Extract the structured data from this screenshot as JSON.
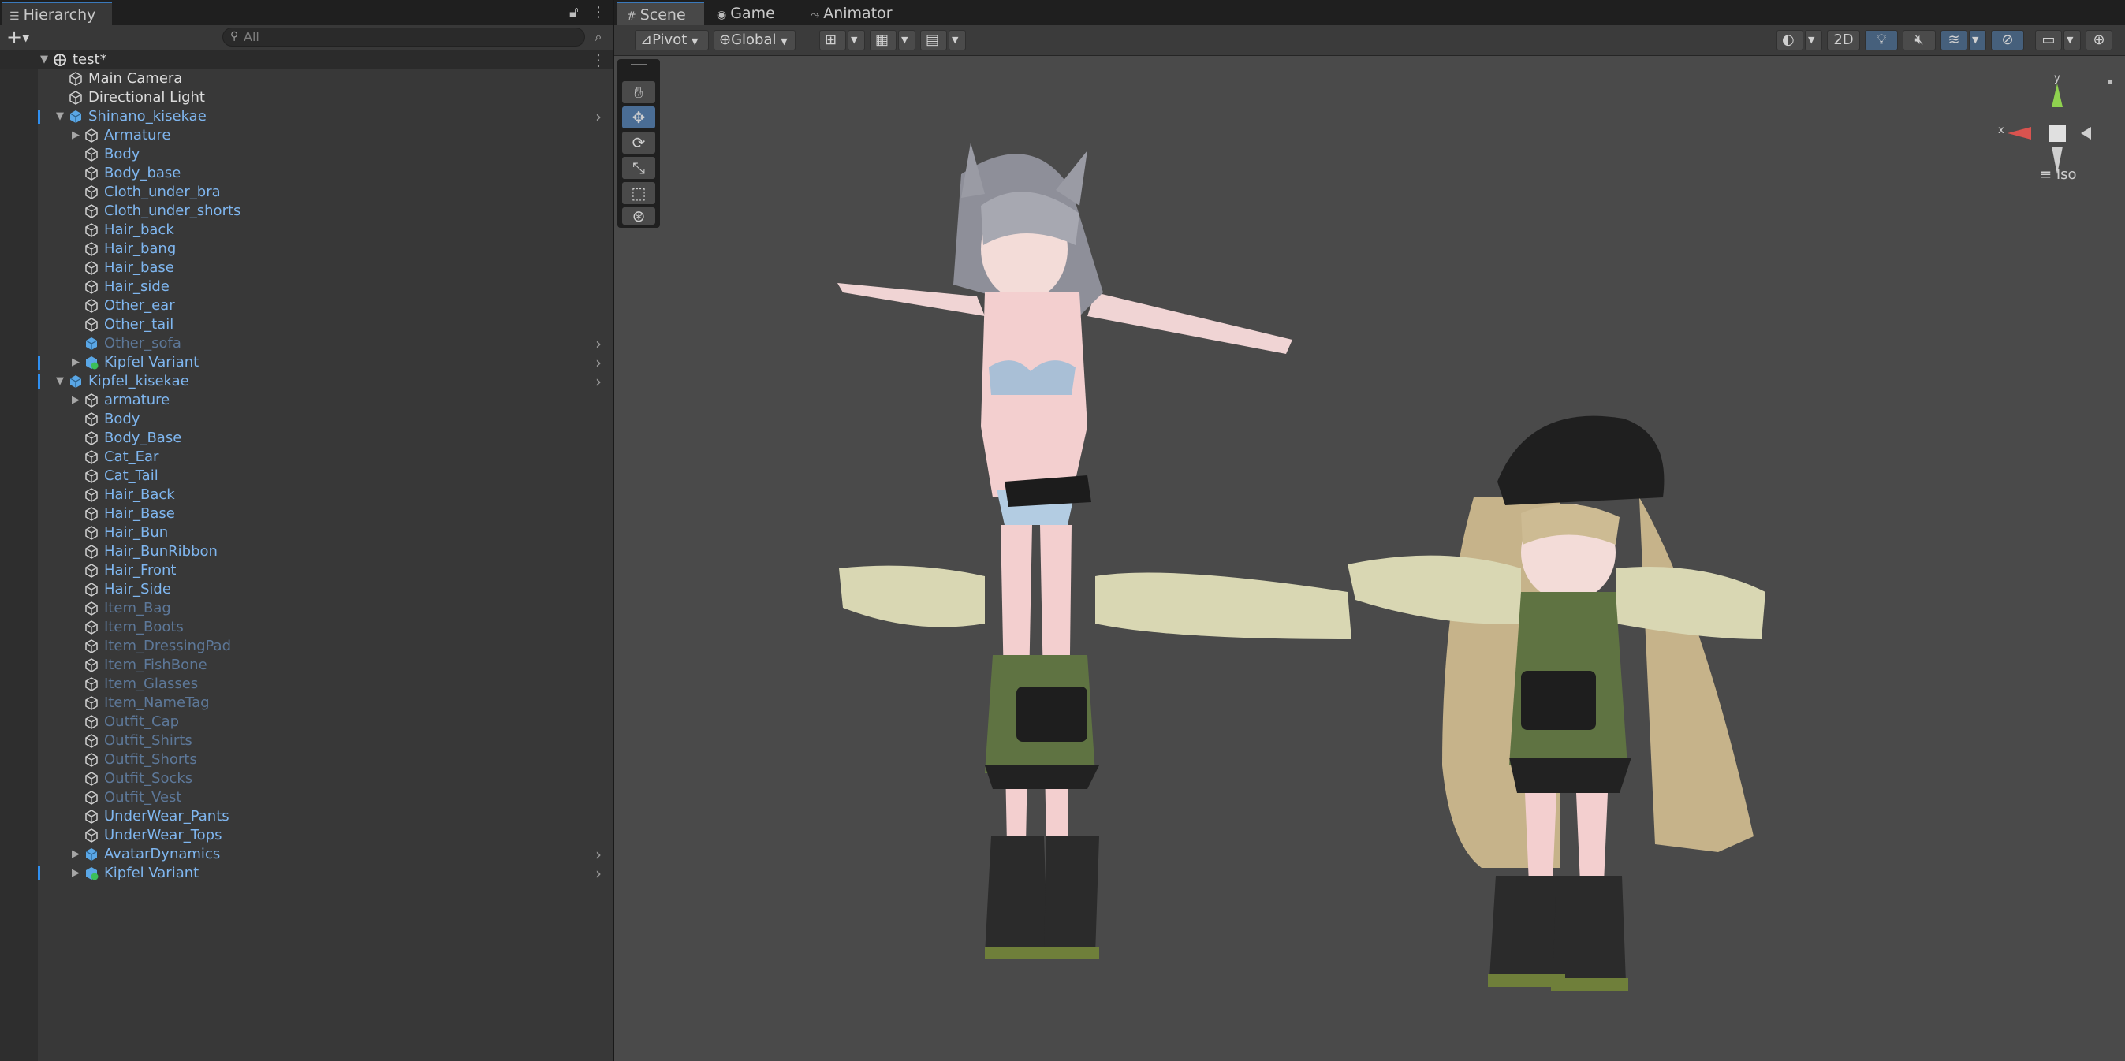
{
  "hierarchy": {
    "tab_label": "Hierarchy",
    "search_placeholder": "All",
    "rows": [
      {
        "label": "test*",
        "indent": 0,
        "kind": "scene",
        "arrow": "down",
        "color": "white"
      },
      {
        "label": "Main Camera",
        "indent": 1,
        "kind": "object",
        "arrow": "",
        "color": "white"
      },
      {
        "label": "Directional Light",
        "indent": 1,
        "kind": "object",
        "arrow": "",
        "color": "white"
      },
      {
        "label": "Shinano_kisekae",
        "indent": 1,
        "kind": "prefab",
        "arrow": "down",
        "color": "blue",
        "more": true,
        "bar": true
      },
      {
        "label": "Armature",
        "indent": 2,
        "kind": "object",
        "arrow": "right",
        "color": "blue"
      },
      {
        "label": "Body",
        "indent": 2,
        "kind": "object",
        "arrow": "",
        "color": "blue"
      },
      {
        "label": "Body_base",
        "indent": 2,
        "kind": "object",
        "arrow": "",
        "color": "blue"
      },
      {
        "label": "Cloth_under_bra",
        "indent": 2,
        "kind": "object",
        "arrow": "",
        "color": "blue"
      },
      {
        "label": "Cloth_under_shorts",
        "indent": 2,
        "kind": "object",
        "arrow": "",
        "color": "blue"
      },
      {
        "label": "Hair_back",
        "indent": 2,
        "kind": "object",
        "arrow": "",
        "color": "blue"
      },
      {
        "label": "Hair_bang",
        "indent": 2,
        "kind": "object",
        "arrow": "",
        "color": "blue"
      },
      {
        "label": "Hair_base",
        "indent": 2,
        "kind": "object",
        "arrow": "",
        "color": "blue"
      },
      {
        "label": "Hair_side",
        "indent": 2,
        "kind": "object",
        "arrow": "",
        "color": "blue"
      },
      {
        "label": "Other_ear",
        "indent": 2,
        "kind": "object",
        "arrow": "",
        "color": "blue"
      },
      {
        "label": "Other_tail",
        "indent": 2,
        "kind": "object",
        "arrow": "",
        "color": "blue"
      },
      {
        "label": "Other_sofa",
        "indent": 2,
        "kind": "prefab",
        "arrow": "",
        "color": "dim",
        "more": true
      },
      {
        "label": "Kipfel Variant",
        "indent": 2,
        "kind": "variant",
        "arrow": "right",
        "color": "blue",
        "more": true,
        "bar": true
      },
      {
        "label": "Kipfel_kisekae",
        "indent": 1,
        "kind": "prefab",
        "arrow": "down",
        "color": "blue",
        "more": true,
        "bar": true
      },
      {
        "label": "armature",
        "indent": 2,
        "kind": "object",
        "arrow": "right",
        "color": "blue"
      },
      {
        "label": "Body",
        "indent": 2,
        "kind": "object",
        "arrow": "",
        "color": "blue"
      },
      {
        "label": "Body_Base",
        "indent": 2,
        "kind": "object",
        "arrow": "",
        "color": "blue"
      },
      {
        "label": "Cat_Ear",
        "indent": 2,
        "kind": "object",
        "arrow": "",
        "color": "blue"
      },
      {
        "label": "Cat_Tail",
        "indent": 2,
        "kind": "object",
        "arrow": "",
        "color": "blue"
      },
      {
        "label": "Hair_Back",
        "indent": 2,
        "kind": "object",
        "arrow": "",
        "color": "blue"
      },
      {
        "label": "Hair_Base",
        "indent": 2,
        "kind": "object",
        "arrow": "",
        "color": "blue"
      },
      {
        "label": "Hair_Bun",
        "indent": 2,
        "kind": "object",
        "arrow": "",
        "color": "blue"
      },
      {
        "label": "Hair_BunRibbon",
        "indent": 2,
        "kind": "object",
        "arrow": "",
        "color": "blue"
      },
      {
        "label": "Hair_Front",
        "indent": 2,
        "kind": "object",
        "arrow": "",
        "color": "blue"
      },
      {
        "label": "Hair_Side",
        "indent": 2,
        "kind": "object",
        "arrow": "",
        "color": "blue"
      },
      {
        "label": "Item_Bag",
        "indent": 2,
        "kind": "object",
        "arrow": "",
        "color": "dim"
      },
      {
        "label": "Item_Boots",
        "indent": 2,
        "kind": "object",
        "arrow": "",
        "color": "dim"
      },
      {
        "label": "Item_DressingPad",
        "indent": 2,
        "kind": "object",
        "arrow": "",
        "color": "dim"
      },
      {
        "label": "Item_FishBone",
        "indent": 2,
        "kind": "object",
        "arrow": "",
        "color": "dim"
      },
      {
        "label": "Item_Glasses",
        "indent": 2,
        "kind": "object",
        "arrow": "",
        "color": "dim"
      },
      {
        "label": "Item_NameTag",
        "indent": 2,
        "kind": "object",
        "arrow": "",
        "color": "dim"
      },
      {
        "label": "Outfit_Cap",
        "indent": 2,
        "kind": "object",
        "arrow": "",
        "color": "dim"
      },
      {
        "label": "Outfit_Shirts",
        "indent": 2,
        "kind": "object",
        "arrow": "",
        "color": "dim"
      },
      {
        "label": "Outfit_Shorts",
        "indent": 2,
        "kind": "object",
        "arrow": "",
        "color": "dim"
      },
      {
        "label": "Outfit_Socks",
        "indent": 2,
        "kind": "object",
        "arrow": "",
        "color": "dim"
      },
      {
        "label": "Outfit_Vest",
        "indent": 2,
        "kind": "object",
        "arrow": "",
        "color": "dim"
      },
      {
        "label": "UnderWear_Pants",
        "indent": 2,
        "kind": "object",
        "arrow": "",
        "color": "blue"
      },
      {
        "label": "UnderWear_Tops",
        "indent": 2,
        "kind": "object",
        "arrow": "",
        "color": "blue"
      },
      {
        "label": "AvatarDynamics",
        "indent": 2,
        "kind": "prefab",
        "arrow": "right",
        "color": "blue",
        "more": true
      },
      {
        "label": "Kipfel Variant",
        "indent": 2,
        "kind": "variant",
        "arrow": "right",
        "color": "blue",
        "more": true,
        "bar": true
      }
    ]
  },
  "scene_view": {
    "tabs": [
      {
        "label": "Scene",
        "icon": "grid-icon"
      },
      {
        "label": "Game",
        "icon": "gamepad-icon"
      },
      {
        "label": "Animator",
        "icon": "animator-icon"
      }
    ],
    "toolbar": {
      "pivot_label": "Pivot",
      "global_label": "Global",
      "mode_2d_label": "2D"
    },
    "gizmo": {
      "axis_y": "y",
      "axis_x": "x",
      "projection_label": "Iso"
    }
  },
  "colors": {
    "accent_blue": "#3a79bb",
    "prefab_blue": "#7fb6ef",
    "inactive": "#5d7899"
  }
}
